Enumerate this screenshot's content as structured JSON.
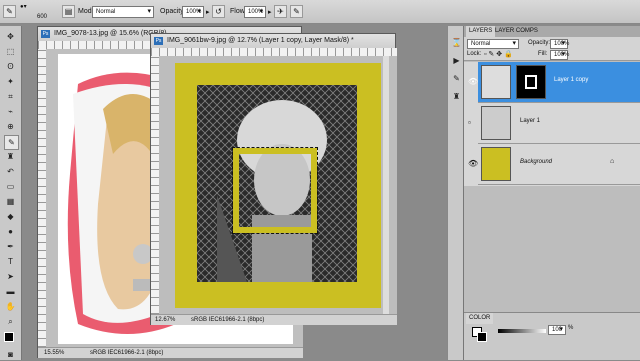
{
  "options_bar": {
    "brush_size": "600",
    "mode_label": "Mode:",
    "mode_value": "Normal",
    "opacity_label": "Opacity:",
    "opacity_value": "100%",
    "flow_label": "Flow:",
    "flow_value": "100%"
  },
  "doc_back": {
    "title": "IMG_9078-13.jpg @ 15.6% (RGB/8)",
    "zoom": "15.55%",
    "profile": "sRGB IEC61966-2.1 (8bpc)"
  },
  "doc_front": {
    "title": "IMG_9061bw-9.jpg @ 12.7% (Layer 1 copy, Layer Mask/8) *",
    "zoom": "12.67%",
    "profile": "sRGB IEC61966-2.1 (8bpc)"
  },
  "layers_panel": {
    "tab_layers": "LAYERS",
    "tab_comps": "LAYER COMPS",
    "blend_mode": "Normal",
    "opacity_label": "Opacity:",
    "opacity_value": "100%",
    "lock_label": "Lock:",
    "fill_label": "Fill:",
    "fill_value": "100%",
    "layers": [
      {
        "name": "Layer 1 copy"
      },
      {
        "name": "Layer 1"
      },
      {
        "name": "Background"
      }
    ]
  },
  "color_panel": {
    "tab": "COLOR",
    "value": "100"
  },
  "colors": {
    "accent_yellow": "#cbbf22",
    "selection_blue": "#3b8fe0"
  }
}
